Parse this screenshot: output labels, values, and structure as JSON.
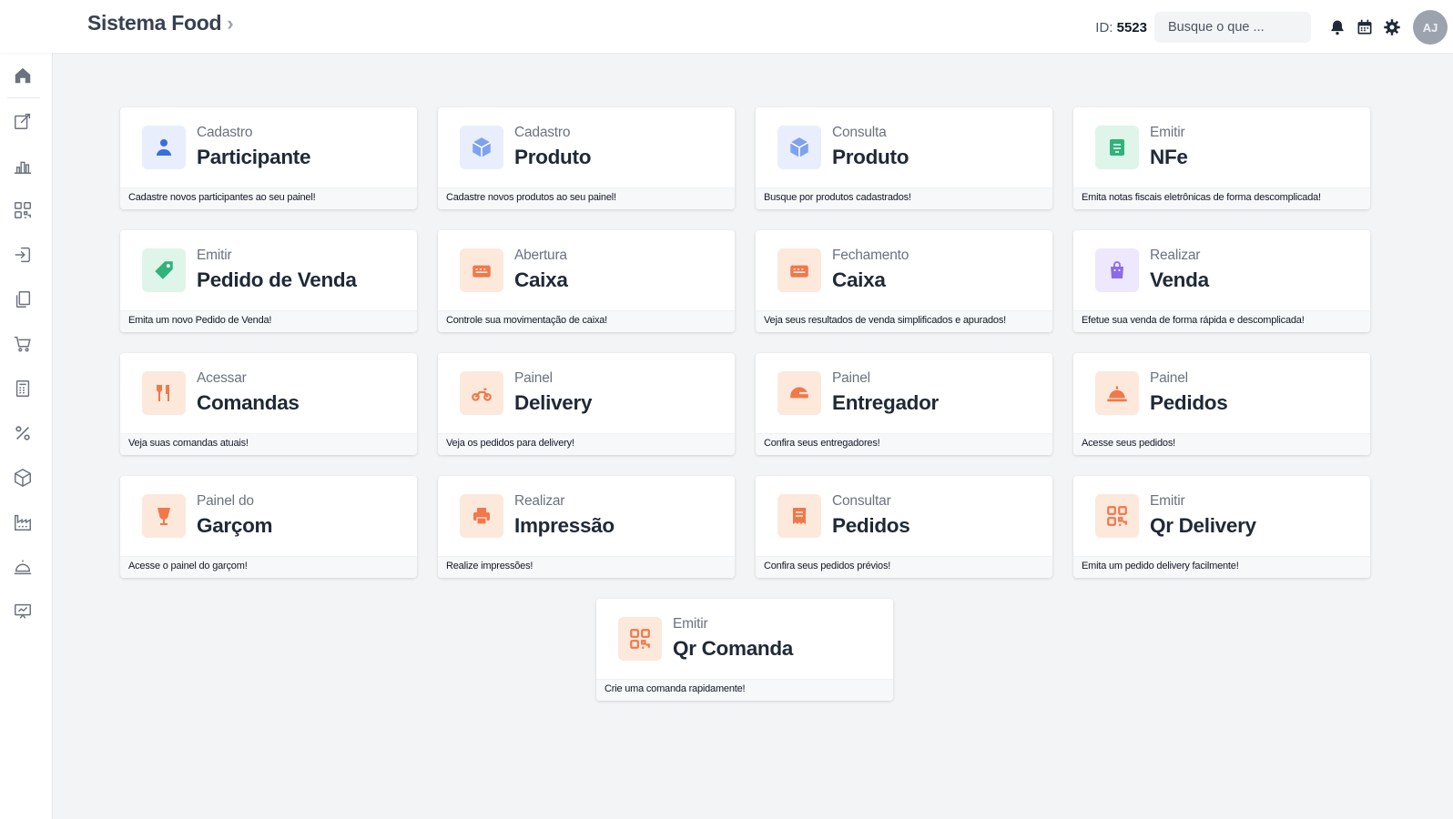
{
  "header": {
    "app_title": "Sistema Food",
    "id_label": "ID:",
    "id_value": "5523",
    "search_placeholder": "Busque o que ...",
    "avatar_initials": "AJ"
  },
  "sidebar": {
    "items": [
      {
        "name": "home",
        "icon": "home-icon"
      },
      {
        "name": "edit",
        "icon": "edit-icon"
      },
      {
        "name": "reports",
        "icon": "bar-chart-icon"
      },
      {
        "name": "qr",
        "icon": "qr-code-icon"
      },
      {
        "name": "login",
        "icon": "login-icon"
      },
      {
        "name": "documents",
        "icon": "copy-icon"
      },
      {
        "name": "cart",
        "icon": "cart-icon"
      },
      {
        "name": "calculator",
        "icon": "calculator-icon"
      },
      {
        "name": "percent",
        "icon": "percent-icon"
      },
      {
        "name": "box",
        "icon": "box-icon"
      },
      {
        "name": "factory",
        "icon": "factory-icon"
      },
      {
        "name": "cloche",
        "icon": "cloche-icon"
      },
      {
        "name": "presentation",
        "icon": "presentation-icon"
      }
    ]
  },
  "cards": [
    {
      "kicker": "Cadastro",
      "title": "Participante",
      "description": "Cadastre novos participantes ao seu painel!",
      "icon": "user-icon",
      "color": "blue"
    },
    {
      "kicker": "Cadastro",
      "title": "Produto",
      "description": "Cadastre novos produtos ao seu painel!",
      "icon": "box-add-icon",
      "color": "blue"
    },
    {
      "kicker": "Consulta",
      "title": "Produto",
      "description": "Busque por produtos cadastrados!",
      "icon": "box-search-icon",
      "color": "blue"
    },
    {
      "kicker": "Emitir",
      "title": "NFe",
      "description": "Emita notas fiscais eletrônicas de forma descomplicada!",
      "icon": "invoice-icon",
      "color": "green"
    },
    {
      "kicker": "Emitir",
      "title": "Pedido de Venda",
      "description": "Emita um novo Pedido de Venda!",
      "icon": "tag-icon",
      "color": "green"
    },
    {
      "kicker": "Abertura",
      "title": "Caixa",
      "description": "Controle sua movimentação de caixa!",
      "icon": "cash-register-icon",
      "color": "orange"
    },
    {
      "kicker": "Fechamento",
      "title": "Caixa",
      "description": "Veja seus resultados de venda simplificados e apurados!",
      "icon": "cash-register-icon",
      "color": "orange"
    },
    {
      "kicker": "Realizar",
      "title": "Venda",
      "description": "Efetue sua venda de forma rápida e descomplicada!",
      "icon": "shopping-bag-icon",
      "color": "purple"
    },
    {
      "kicker": "Acessar",
      "title": "Comandas",
      "description": "Veja suas comandas atuais!",
      "icon": "cutlery-icon",
      "color": "orange"
    },
    {
      "kicker": "Painel",
      "title": "Delivery",
      "description": "Veja os pedidos para delivery!",
      "icon": "motorcycle-icon",
      "color": "orange"
    },
    {
      "kicker": "Painel",
      "title": "Entregador",
      "description": "Confira seus entregadores!",
      "icon": "helmet-icon",
      "color": "orange"
    },
    {
      "kicker": "Painel",
      "title": "Pedidos",
      "description": "Acesse seus pedidos!",
      "icon": "cloche-icon",
      "color": "orange"
    },
    {
      "kicker": "Painel do",
      "title": "Garçom",
      "description": "Acesse o painel do garçom!",
      "icon": "waiter-icon",
      "color": "orange"
    },
    {
      "kicker": "Realizar",
      "title": "Impressão",
      "description": "Realize impressões!",
      "icon": "printer-icon",
      "color": "orange"
    },
    {
      "kicker": "Consultar",
      "title": "Pedidos",
      "description": "Confira seus pedidos prévios!",
      "icon": "receipt-icon",
      "color": "orange"
    },
    {
      "kicker": "Emitir",
      "title": "Qr Delivery",
      "description": "Emita um pedido delivery facilmente!",
      "icon": "qr-code-icon",
      "color": "orange"
    },
    {
      "kicker": "Emitir",
      "title": "Qr Comanda",
      "description": "Crie uma comanda rapidamente!",
      "icon": "qr-code-icon",
      "color": "orange"
    }
  ]
}
